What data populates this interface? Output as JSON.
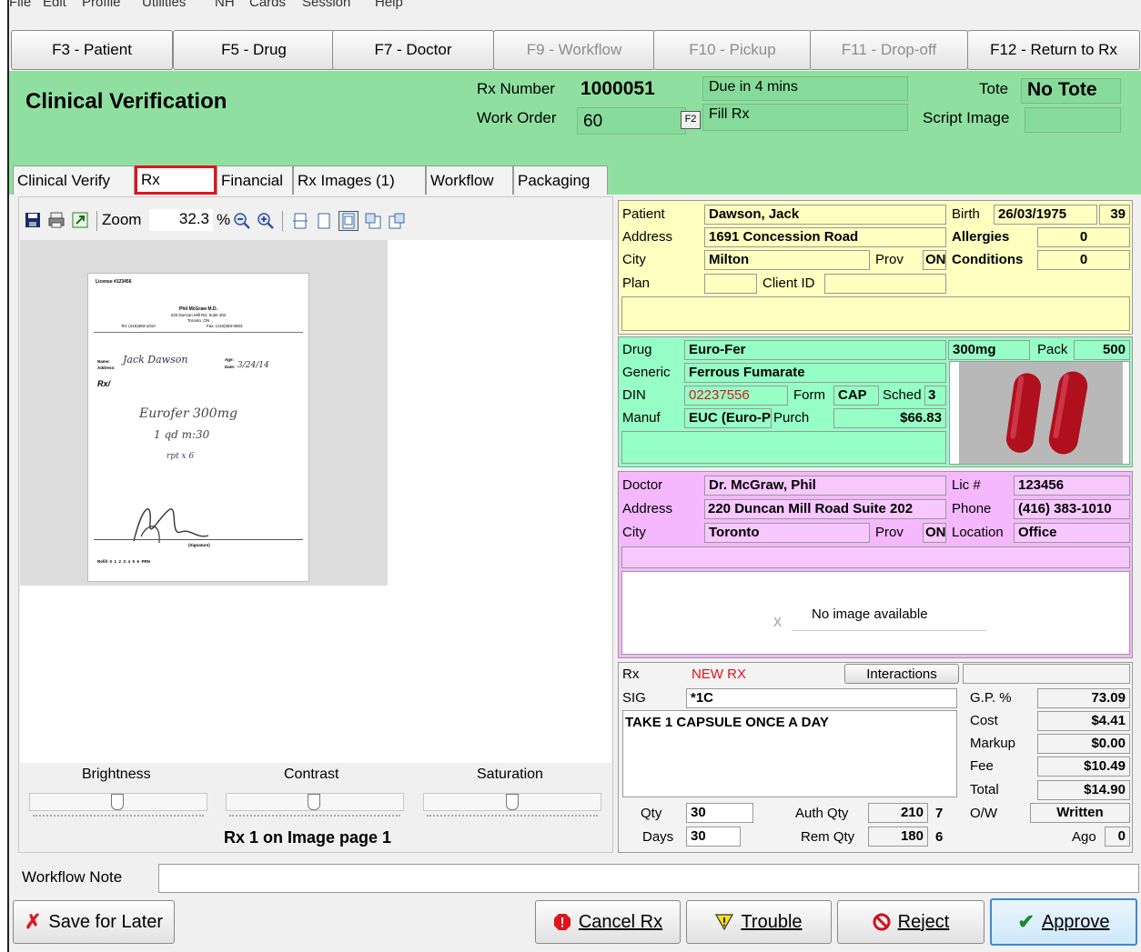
{
  "menu": [
    "File",
    "Edit",
    "Profile",
    "Utilities",
    "NH",
    "Cards",
    "Session",
    "Help"
  ],
  "fkeys": [
    {
      "label": "F3 - Patient",
      "enabled": true
    },
    {
      "label": "F5 - Drug",
      "enabled": true
    },
    {
      "label": "F7 - Doctor",
      "enabled": true
    },
    {
      "label": "F9 - Workflow",
      "enabled": false
    },
    {
      "label": "F10 - Pickup",
      "enabled": false
    },
    {
      "label": "F11 - Drop-off",
      "enabled": false
    },
    {
      "label": "F12 - Return to Rx",
      "enabled": true
    }
  ],
  "header": {
    "title": "Clinical Verification",
    "rx_number_label": "Rx Number",
    "rx_number": "1000051",
    "due": "Due in 4 mins",
    "work_order_label": "Work Order",
    "work_order": "60",
    "f2_key": "F2",
    "fill_rx": "Fill Rx",
    "tote_label": "Tote",
    "tote_value": "No Tote",
    "script_image_label": "Script Image"
  },
  "tabs": [
    "Clinical Verify",
    "Rx",
    "Financial",
    "Rx Images (1)",
    "Workflow",
    "Packaging"
  ],
  "viewer": {
    "zoom_label": "Zoom",
    "zoom_value": "32.3",
    "zoom_unit": "%",
    "brightness": "Brightness",
    "contrast": "Contrast",
    "saturation": "Saturation",
    "page_info": "Rx 1 on Image page 1",
    "scan": {
      "license": "License #123456",
      "doctor": "Phil McGraw M.D.",
      "addr1": "220 Duncan Mill Rd, Suite 202",
      "addr2": "Toronto, ON",
      "tel": "Tel: (416)383-1010",
      "fax": "Fax: (416)383-0803",
      "name_label": "Name:",
      "patient": "Jack Dawson",
      "address_label": "Address:",
      "age_label": "Age:",
      "date_label": "Date:",
      "date": "3/24/14",
      "rx_mark": "Rx/",
      "line1": "Eurofer 300mg",
      "line2": "1 qd  m:30",
      "line3": "rpt x 6",
      "signature_label": "(Signature)",
      "refill": "Refill  0  1  2  3  4  5  6  PRN"
    }
  },
  "patient": {
    "patient_label": "Patient",
    "name": "Dawson, Jack",
    "address_label": "Address",
    "address": "1691 Concession Road",
    "city_label": "City",
    "city": "Milton",
    "prov_label": "Prov",
    "prov": "ON",
    "plan_label": "Plan",
    "client_id_label": "Client ID",
    "birth_label": "Birth",
    "birth": "26/03/1975",
    "age": "39",
    "allergies_label": "Allergies",
    "allergies": "0",
    "conditions_label": "Conditions",
    "conditions": "0"
  },
  "drug": {
    "drug_label": "Drug",
    "name": "Euro-Fer",
    "strength": "300mg",
    "pack_label": "Pack",
    "pack": "500",
    "generic_label": "Generic",
    "generic": "Ferrous Fumarate",
    "din_label": "DIN",
    "din": "02237556",
    "form_label": "Form",
    "form": "CAP",
    "sched_label": "Sched",
    "sched": "3",
    "manuf_label": "Manuf",
    "manuf": "EUC (Euro-Pha",
    "purch_label": "Purch",
    "purch": "$66.83"
  },
  "doctor": {
    "doctor_label": "Doctor",
    "name": "Dr. McGraw, Phil",
    "lic_label": "Lic #",
    "lic": "123456",
    "address_label": "Address",
    "address": "220 Duncan Mill Road Suite 202",
    "phone_label": "Phone",
    "phone": "(416) 383-1010",
    "city_label": "City",
    "city": "Toronto",
    "prov_label": "Prov",
    "prov": "ON",
    "location_label": "Location",
    "location": "Office",
    "no_image": "No image available",
    "no_image_mark": "x"
  },
  "rx": {
    "rx_label": "Rx",
    "status": "NEW RX",
    "interactions": "Interactions",
    "sig_label": "SIG",
    "sig": "*1C",
    "sig_text": "TAKE 1 CAPSULE ONCE A DAY",
    "gp_label": "G.P. %",
    "gp": "73.09",
    "cost_label": "Cost",
    "cost": "$4.41",
    "markup_label": "Markup",
    "markup": "$0.00",
    "fee_label": "Fee",
    "fee": "$10.49",
    "total_label": "Total",
    "total": "$14.90",
    "qty_label": "Qty",
    "qty": "30",
    "days_label": "Days",
    "days": "30",
    "auth_qty_label": "Auth Qty",
    "auth_qty": "210",
    "auth_count": "7",
    "rem_qty_label": "Rem Qty",
    "rem_qty": "180",
    "rem_count": "6",
    "ow_label": "O/W",
    "ow": "Written",
    "ago_label": "Ago",
    "ago": "0"
  },
  "footer": {
    "workflow_note_label": "Workflow Note",
    "workflow_note": "",
    "save_for_later": "Save for Later",
    "cancel_rx": "Cancel Rx",
    "trouble": "Trouble",
    "reject": "Reject",
    "approve": "Approve"
  },
  "colors": {
    "header_green": "#8fe0a0",
    "patient_yellow": "#ffffc0",
    "drug_mint": "#95ffc6",
    "doctor_pink": "#f5b8ff",
    "alert_red": "#e0141e"
  }
}
